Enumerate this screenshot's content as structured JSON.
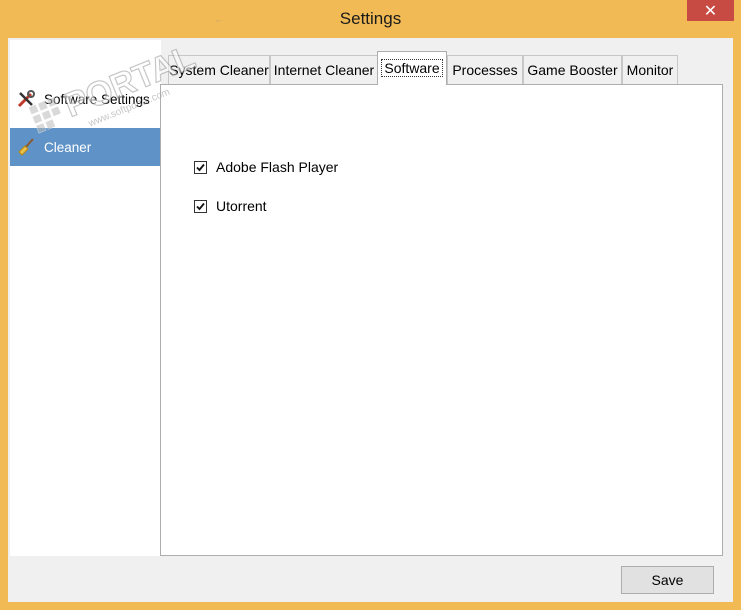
{
  "window": {
    "title": "Settings",
    "close_glyph": "✕"
  },
  "nav": {
    "items": [
      {
        "label": "Software Settings",
        "icon": "wrench-screwdriver-icon",
        "selected": false
      },
      {
        "label": "Cleaner",
        "icon": "broom-icon",
        "selected": true
      }
    ]
  },
  "tabs": [
    {
      "label": "System Cleaner",
      "active": false
    },
    {
      "label": "Internet Cleaner",
      "active": false
    },
    {
      "label": "Software",
      "active": true
    },
    {
      "label": "Processes",
      "active": false
    },
    {
      "label": "Game Booster",
      "active": false
    },
    {
      "label": "Monitor",
      "active": false
    }
  ],
  "software_list": [
    {
      "label": "Adobe Flash Player",
      "checked": true
    },
    {
      "label": "Utorrent",
      "checked": true
    }
  ],
  "footer": {
    "save_label": "Save"
  },
  "watermark": {
    "text": "PORTAL",
    "sub": "www.softportal.com",
    "tm": "™"
  },
  "colors": {
    "frame": "#f1ba55",
    "close": "#c74a43",
    "nav_selected": "#5f93c8"
  }
}
